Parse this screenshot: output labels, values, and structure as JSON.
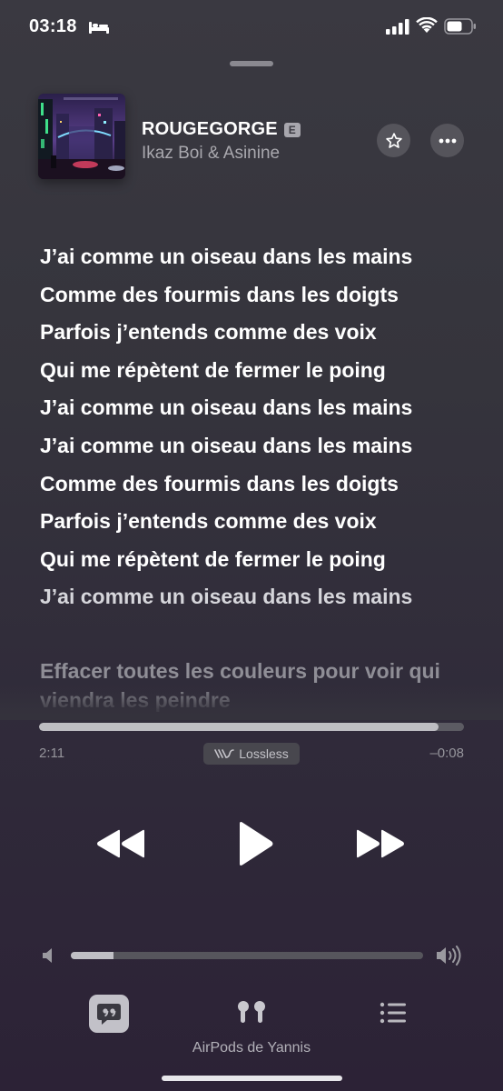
{
  "status_bar": {
    "time": "03:18"
  },
  "now_playing": {
    "title": "ROUGEGORGE",
    "explicit_badge": "E",
    "artist": "Ikaz Boi & Asinine"
  },
  "lyrics": {
    "lines": [
      "J’ai comme un oiseau dans les mains",
      "Comme des fourmis dans les doigts",
      "Parfois j’entends comme des voix",
      "Qui me répètent de fermer le poing",
      "J’ai comme un oiseau dans les mains",
      "J’ai comme un oiseau dans les mains",
      "Comme des fourmis dans les doigts",
      "Parfois j’entends comme des voix",
      "Qui me répètent de fermer le poing",
      "J’ai comme un oiseau dans les mains"
    ],
    "next_line": "Effacer toutes les couleurs pour voir qui viendra les peindre"
  },
  "playback": {
    "elapsed": "2:11",
    "remaining": "–0:08",
    "progress_fraction": 0.94,
    "quality_label": "Lossless"
  },
  "volume": {
    "level_fraction": 0.12
  },
  "bottom_bar": {
    "output_device": "AirPods de Yannis"
  },
  "colors": {
    "accent": "#ffffff",
    "secondary_text": "#a9a8ae",
    "track": "#5c5b63"
  }
}
